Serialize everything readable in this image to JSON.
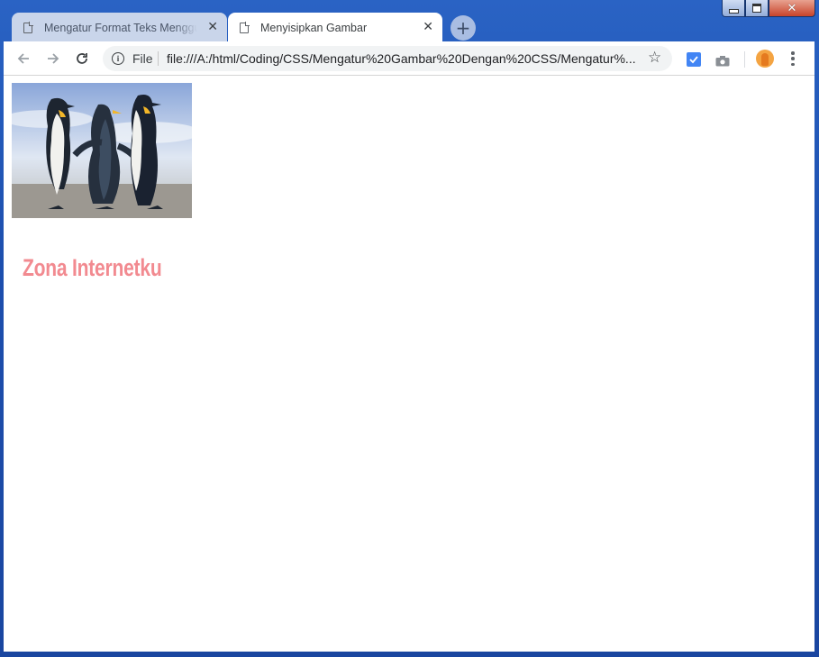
{
  "browser": {
    "tabs": [
      {
        "title": "Mengatur Format Teks Menggunakan",
        "active": false
      },
      {
        "title": "Menyisipkan Gambar",
        "active": true
      }
    ],
    "address": {
      "scheme_label": "File",
      "url": "file:///A:/html/Coding/CSS/Mengatur%20Gambar%20Dengan%20CSS/Mengatur%..."
    }
  },
  "page": {
    "heading": "Zona Internetku",
    "heading_color": "#f28a90"
  },
  "icons": {
    "tab": "page-icon",
    "info": "info-icon",
    "bookmark": "star-icon",
    "extension": "extension-icon",
    "camera": "camera-icon",
    "menu": "more-vert-icon"
  }
}
